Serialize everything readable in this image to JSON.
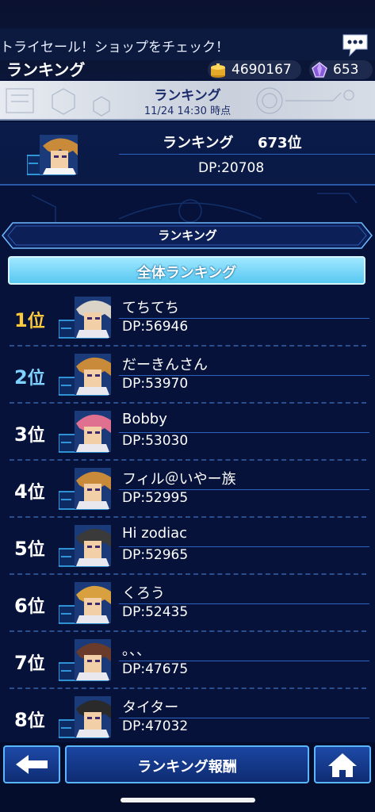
{
  "header": {
    "ticker": "トライセール！ショップをチェック！",
    "title": "ランキング",
    "gold": "4690167",
    "gems": "653"
  },
  "banner": {
    "title": "ランキング",
    "subtitle": "11/24 14:30 時点"
  },
  "my_rank": {
    "label": "ランキング",
    "rank": "673位",
    "dp": "DP:20708"
  },
  "panel": {
    "header": "ランキング",
    "tab": "全体ランキング"
  },
  "rows": [
    {
      "rank": "1",
      "suffix": "位",
      "name": "てちてち",
      "dp": "DP:56946",
      "rank_color": "#ffc93c"
    },
    {
      "rank": "2",
      "suffix": "位",
      "name": "だーきんさん",
      "dp": "DP:53970",
      "rank_color": "#7fd2ff"
    },
    {
      "rank": "3",
      "suffix": "位",
      "name": "Bobby",
      "dp": "DP:53030",
      "rank_color": "#ffffff"
    },
    {
      "rank": "4",
      "suffix": "位",
      "name": "フィル＠いやー族",
      "dp": "DP:52995",
      "rank_color": "#ffffff"
    },
    {
      "rank": "5",
      "suffix": "位",
      "name": "Hi zodiac",
      "dp": "DP:52965",
      "rank_color": "#ffffff"
    },
    {
      "rank": "6",
      "suffix": "位",
      "name": "くろう",
      "dp": "DP:52435",
      "rank_color": "#ffffff"
    },
    {
      "rank": "7",
      "suffix": "位",
      "name": "。、、",
      "dp": "DP:47675",
      "rank_color": "#ffffff"
    },
    {
      "rank": "8",
      "suffix": "位",
      "name": "タイター",
      "dp": "DP:47032",
      "rank_color": "#ffffff"
    }
  ],
  "footer": {
    "reward_label": "ランキング報酬"
  },
  "icons": {
    "chat": "chat-bubble-icon",
    "gold": "gold-coins-icon",
    "gem": "purple-gem-icon",
    "back": "back-arrow-icon",
    "home": "home-icon"
  }
}
